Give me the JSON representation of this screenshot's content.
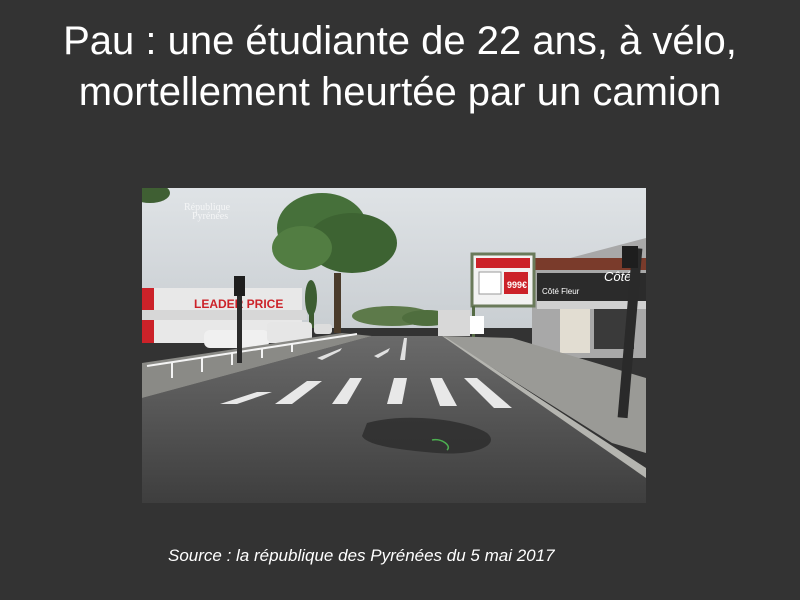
{
  "slide": {
    "title": "Pau : une étudiante de 22 ans, à vélo, mortellement heurtée par un camion",
    "source": "Source : la république des Pyrénées du 5 mai 2017"
  },
  "photo": {
    "watermark_line1": "République",
    "watermark_line2": "Pyrénées",
    "store_sign": "LEADER PRICE",
    "billboard_price": "999€",
    "shop_sign": "Côté",
    "shop_sign_sub": "Côté Fleur"
  },
  "colors": {
    "background": "#333333",
    "text": "#ffffff",
    "store_red": "#cc2229"
  }
}
